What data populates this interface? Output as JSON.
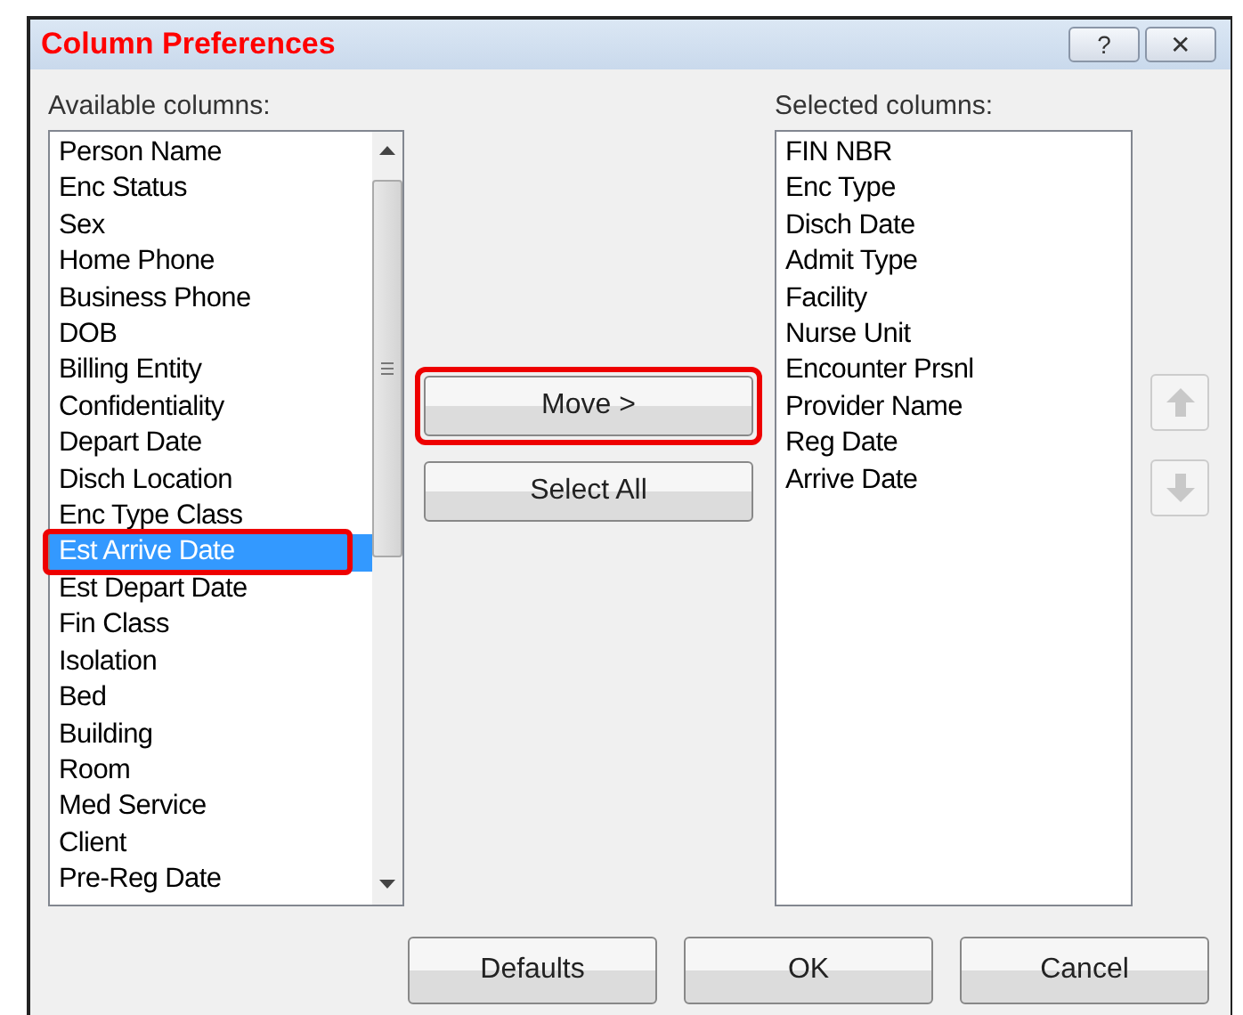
{
  "window": {
    "title": "Column Preferences",
    "help": "?",
    "close": "✕"
  },
  "available": {
    "label": "Available columns:",
    "items": [
      {
        "text": "Person Name",
        "selected": false,
        "annotated": false
      },
      {
        "text": "Enc Status",
        "selected": false,
        "annotated": false
      },
      {
        "text": "Sex",
        "selected": false,
        "annotated": false
      },
      {
        "text": "Home Phone",
        "selected": false,
        "annotated": false
      },
      {
        "text": "Business Phone",
        "selected": false,
        "annotated": false
      },
      {
        "text": "DOB",
        "selected": false,
        "annotated": false
      },
      {
        "text": "Billing Entity",
        "selected": false,
        "annotated": false
      },
      {
        "text": "Confidentiality",
        "selected": false,
        "annotated": false
      },
      {
        "text": "Depart Date",
        "selected": false,
        "annotated": false
      },
      {
        "text": "Disch Location",
        "selected": false,
        "annotated": false
      },
      {
        "text": "Enc Type Class",
        "selected": false,
        "annotated": false
      },
      {
        "text": "Est Arrive Date",
        "selected": true,
        "annotated": true
      },
      {
        "text": "Est Depart Date",
        "selected": false,
        "annotated": false
      },
      {
        "text": "Fin Class",
        "selected": false,
        "annotated": false
      },
      {
        "text": "Isolation",
        "selected": false,
        "annotated": false
      },
      {
        "text": "Bed",
        "selected": false,
        "annotated": false
      },
      {
        "text": "Building",
        "selected": false,
        "annotated": false
      },
      {
        "text": "Room",
        "selected": false,
        "annotated": false
      },
      {
        "text": "Med Service",
        "selected": false,
        "annotated": false
      },
      {
        "text": "Client",
        "selected": false,
        "annotated": false
      },
      {
        "text": "Pre-Reg Date",
        "selected": false,
        "annotated": false
      }
    ]
  },
  "actions": [
    {
      "label": "Move >",
      "annotated": true
    },
    {
      "label": "Select All",
      "annotated": false
    }
  ],
  "selected": {
    "label": "Selected columns:",
    "items": [
      {
        "text": "FIN NBR",
        "selected": false
      },
      {
        "text": "Enc Type",
        "selected": false
      },
      {
        "text": "Disch Date",
        "selected": false
      },
      {
        "text": "Admit Type",
        "selected": false
      },
      {
        "text": "Facility",
        "selected": false
      },
      {
        "text": "Nurse Unit",
        "selected": false
      },
      {
        "text": "Encounter Prsnl",
        "selected": false
      },
      {
        "text": "Provider Name",
        "selected": false
      },
      {
        "text": "Reg Date",
        "selected": false
      },
      {
        "text": "Arrive Date",
        "selected": false
      }
    ]
  },
  "order_buttons": [
    {
      "kind": "up",
      "disabled": true
    },
    {
      "kind": "down",
      "disabled": true
    }
  ],
  "buttons": [
    "Defaults",
    "OK",
    "Cancel"
  ]
}
